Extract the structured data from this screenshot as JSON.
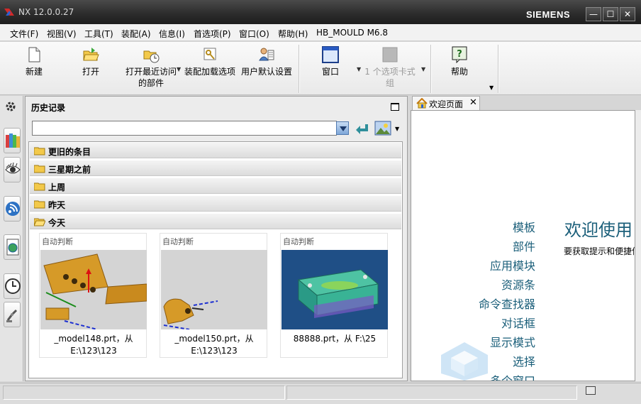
{
  "window": {
    "title": "NX 12.0.0.27",
    "brand": "SIEMENS"
  },
  "menu": [
    "文件(F)",
    "视图(V)",
    "工具(T)",
    "装配(A)",
    "信息(I)",
    "首选项(P)",
    "窗口(O)",
    "帮助(H)",
    "HB_MOULD M6.8"
  ],
  "toolbar": {
    "new": "新建",
    "open": "打开",
    "recent_line1": "打开最近访问",
    "recent_line2": "的部件",
    "assembly_load": "装配加载选项",
    "user_defaults": "用户默认设置",
    "window": "窗口",
    "tab_group_line1": "1 个选项卡式",
    "tab_group_line2": "组",
    "help": "帮助"
  },
  "history": {
    "title": "历史记录",
    "search_value": "",
    "groups": [
      "更旧的条目",
      "三星期之前",
      "上周",
      "昨天",
      "今天"
    ],
    "cards": [
      {
        "tag": "自动判断",
        "name_line1": "_model148.prt，从",
        "name_line2": "E:\\123\\123"
      },
      {
        "tag": "自动判断",
        "name_line1": "_model150.prt，从",
        "name_line2": "E:\\123\\123"
      },
      {
        "tag": "自动判断",
        "name_line1": "88888.prt，从 F:\\25",
        "name_line2": ""
      }
    ]
  },
  "welcome_tab": {
    "label": "欢迎页面",
    "nav": [
      "模板",
      "部件",
      "应用模块",
      "资源条",
      "命令查找器",
      "对话框",
      "显示模式",
      "选择",
      "多个窗口"
    ],
    "title": "欢迎使用",
    "subtitle": "要获取提示和便捷信"
  },
  "colors": {
    "accent_link": "#1b5f7a",
    "title_bar": "#2b2b2b"
  }
}
